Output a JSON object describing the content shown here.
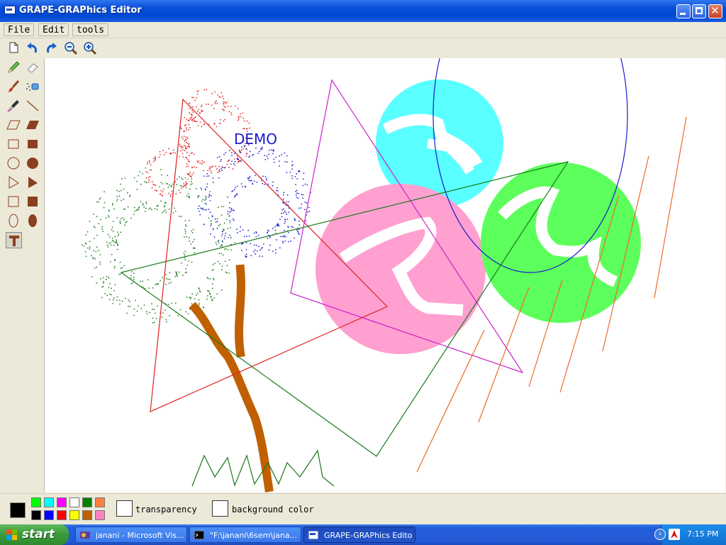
{
  "window": {
    "title": "GRAPE-GRAPhics Editor",
    "controls": [
      "minimize",
      "maximize",
      "close"
    ]
  },
  "menu": {
    "items": [
      "File",
      "Edit",
      "tools"
    ]
  },
  "toolbar": {
    "buttons": [
      "new-file-icon",
      "undo-icon",
      "redo-icon",
      "zoom-out-icon",
      "zoom-in-icon"
    ]
  },
  "tools": {
    "items": [
      "pencil",
      "eraser",
      "brush",
      "spray",
      "color-picker",
      "line",
      "parallelogram-outline",
      "parallelogram-filled",
      "rectangle-outline",
      "rectangle-filled",
      "circle-outline",
      "circle-filled",
      "triangle-outline",
      "triangle-filled",
      "square-outline",
      "square-filled",
      "ellipse-outline",
      "ellipse-filled",
      "text"
    ],
    "selected": "text"
  },
  "canvas": {
    "demo_text": "DEMO",
    "colors": {
      "red": "#e02020",
      "green": "#1a7a1a",
      "magenta": "#cc22cc",
      "blue": "#1a1ad0",
      "cyan": "#5affff",
      "pink": "#ffa0d0",
      "lime": "#5cff5c",
      "brown": "#c06000",
      "orange": "#ee6a2a"
    }
  },
  "palette": {
    "current_color": "#000000",
    "swatches": [
      "#00ff00",
      "#00ffff",
      "#ff00ff",
      "#ffffff",
      "#008000",
      "#ff8040",
      "#000000",
      "#0000ff",
      "#ff0000",
      "#ffff00",
      "#c06000",
      "#ff80c0"
    ],
    "transparency_label": "transparency",
    "background_label": "background color"
  },
  "taskbar": {
    "start_label": "start",
    "tasks": [
      {
        "label": "janani - Microsoft Vis...",
        "active": false
      },
      {
        "label": "\"F:\\janani\\6sem\\jana...",
        "active": false
      },
      {
        "label": "GRAPE-GRAPhics Editor",
        "active": true
      }
    ],
    "clock": "7:15 PM"
  }
}
